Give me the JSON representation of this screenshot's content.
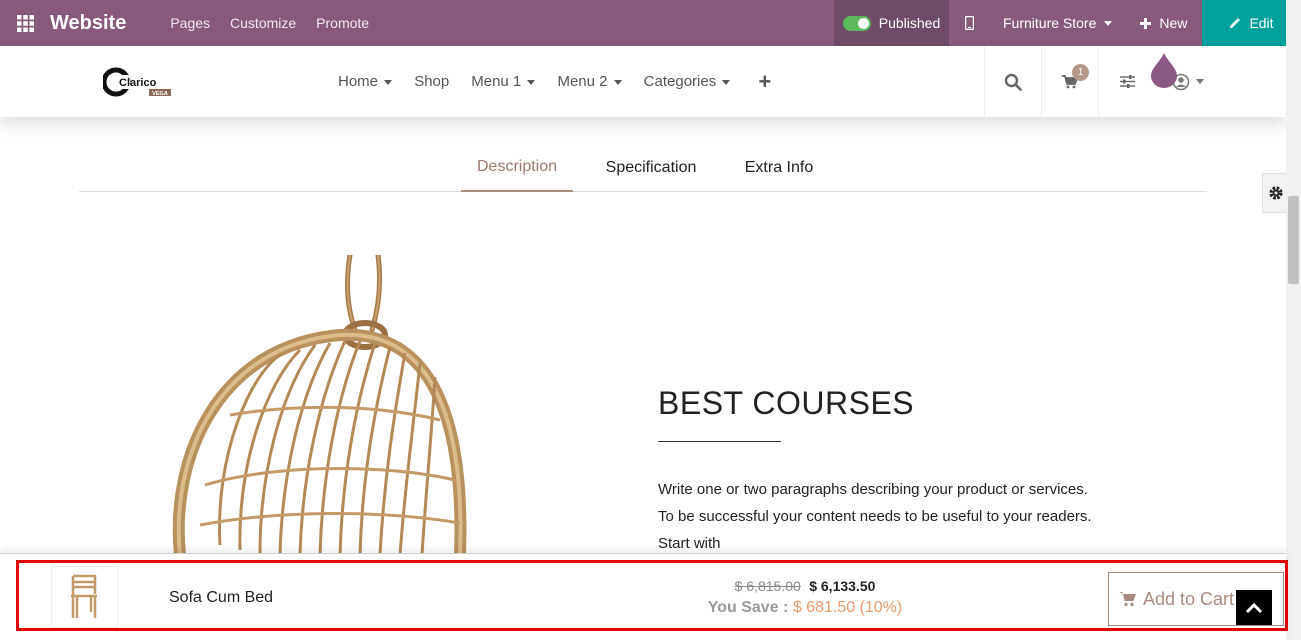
{
  "adminbar": {
    "brand": "Website",
    "menu": [
      "Pages",
      "Customize",
      "Promote"
    ],
    "published_label": "Published",
    "store_label": "Furniture Store",
    "new_label": "New",
    "edit_label": "Edit",
    "bg_color": "#875a7b",
    "edit_color": "#00a09d"
  },
  "header": {
    "logo_text": "Clarico",
    "logo_sub": "VEGA",
    "nav": {
      "home": "Home",
      "shop": "Shop",
      "menu1": "Menu 1",
      "menu2": "Menu 2",
      "categories": "Categories"
    },
    "cart_count": "1"
  },
  "tabs": {
    "description": "Description",
    "specification": "Specification",
    "extra_info": "Extra Info"
  },
  "content": {
    "heading": "BEST COURSES",
    "lines": [
      "Write one or two paragraphs describing your product or services.",
      "To be successful your content needs to be useful to your readers.",
      "Start with"
    ]
  },
  "sticky": {
    "product_name": "Sofa Cum Bed",
    "old_price": "$ 6,815.00",
    "new_price": "$ 6,133.50",
    "save_label": "You Save :",
    "save_amount": "$ 681.50 (10%)",
    "add_to_cart": "Add to Cart",
    "accent_color": "#a88b7d",
    "highlight_color": "#e00000"
  },
  "icons": {
    "apps": "apps-grid-icon",
    "mobile": "mobile-icon",
    "plus": "plus-icon",
    "pencil": "pencil-icon",
    "search": "search-icon",
    "cart": "cart-icon",
    "filters": "sliders-icon",
    "user": "user-icon",
    "gear": "gear-icon",
    "back_to_top": "chevron-up-icon"
  }
}
